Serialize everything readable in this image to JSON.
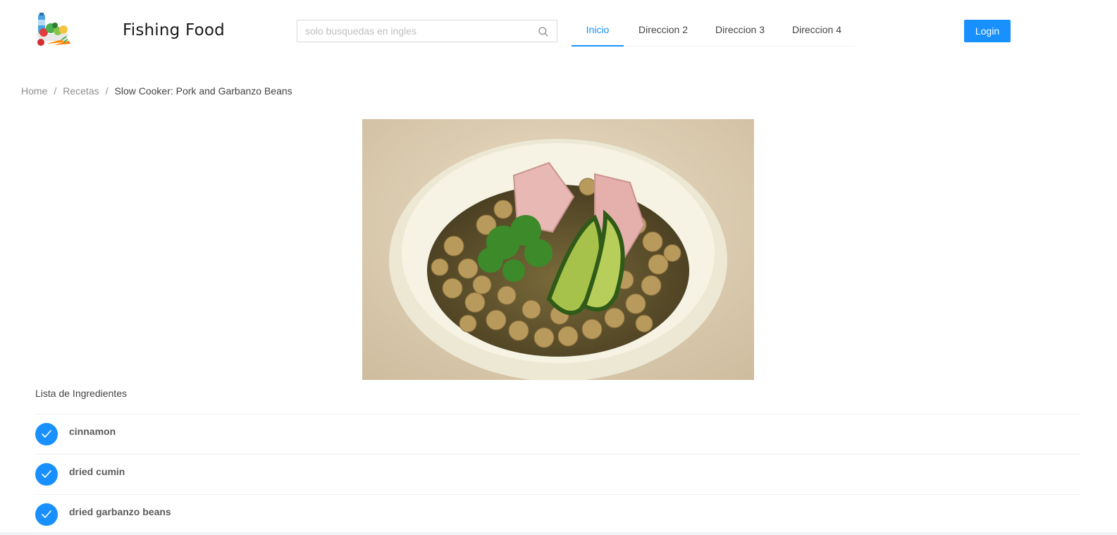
{
  "header": {
    "brand": "Fishing Food",
    "logo_icon": "vegetables-logo-icon",
    "search": {
      "placeholder": "solo busquedas en ingles",
      "value": "",
      "icon": "search-icon"
    },
    "nav": [
      {
        "label": "Inicio",
        "active": true
      },
      {
        "label": "Direccion 2",
        "active": false
      },
      {
        "label": "Direccion 3",
        "active": false
      },
      {
        "label": "Direccion 4",
        "active": false
      }
    ],
    "login_label": "Login"
  },
  "breadcrumb": {
    "items": [
      "Home",
      "Recetas"
    ],
    "current": "Slow Cooker: Pork and Garbanzo Beans"
  },
  "recipe": {
    "image_alt": "Slow Cooker: Pork and Garbanzo Beans",
    "ingredients_title": "Lista de Ingredientes",
    "ingredients": [
      "cinnamon",
      "dried cumin",
      "dried garbanzo beans"
    ],
    "check_icon": "check-circle-icon"
  },
  "colors": {
    "primary": "#1890ff",
    "header_bg": "#ffffff",
    "page_bg": "#ffffff"
  }
}
